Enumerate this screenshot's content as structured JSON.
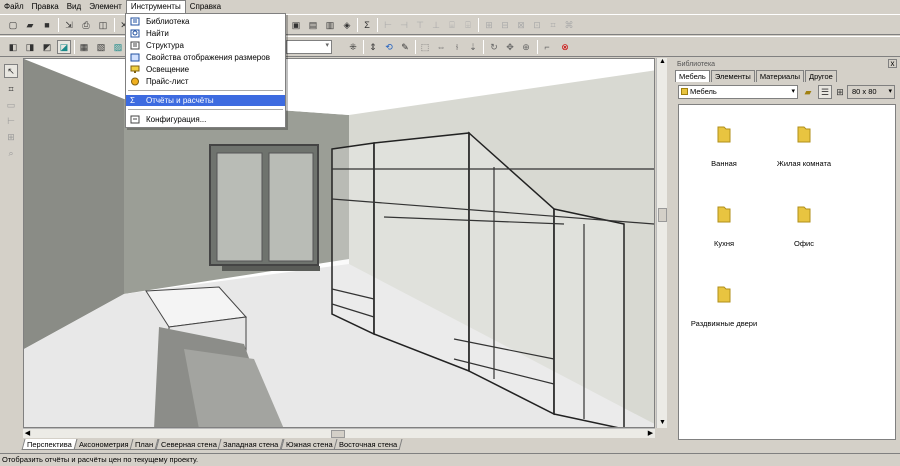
{
  "menu": [
    "Файл",
    "Правка",
    "Вид",
    "Элемент",
    "Инструменты",
    "Справка"
  ],
  "active_menu_index": 4,
  "dropdown": {
    "items": [
      {
        "label": "Библиотека",
        "icon": "library-icon"
      },
      {
        "label": "Найти",
        "icon": "find-icon"
      },
      {
        "label": "Структура",
        "icon": "structure-icon"
      },
      {
        "label": "Свойства отображения размеров",
        "icon": "dimensions-icon"
      },
      {
        "label": "Освещение",
        "icon": "lighting-icon"
      },
      {
        "label": "Прайс-лист",
        "icon": "price-list-icon"
      },
      {
        "label": "Отчёты и расчёты",
        "icon": "reports-icon",
        "highlighted": true
      },
      {
        "label": "Конфигурация...",
        "icon": "configuration-icon"
      }
    ]
  },
  "view_tabs": [
    "Перспектива",
    "Аксонометрия",
    "План",
    "Северная стена",
    "Западная стена",
    "Южная стена",
    "Восточная стена"
  ],
  "active_view_tab": 0,
  "status_text": "Отобразить отчёты и расчёты цен по текущему проекту.",
  "library": {
    "title": "Библиотека",
    "close": "x",
    "tabs": [
      "Мебель",
      "Элементы",
      "Материалы",
      "Другое"
    ],
    "active_tab": 0,
    "path": "Мебель",
    "icon_size": "80 x 80",
    "folders": [
      "Ванная",
      "Жилая комната",
      "Кухня",
      "Офис",
      "Раздвижные двери"
    ]
  },
  "colors": {
    "highlight": "#3d6be0",
    "folder": "#e8c440",
    "chrome": "#d4d0c8"
  }
}
